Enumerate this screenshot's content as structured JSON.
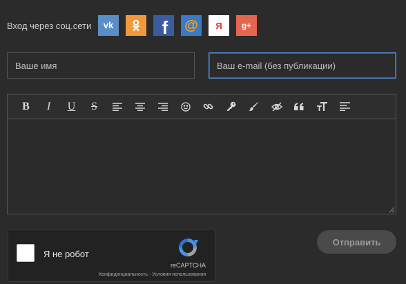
{
  "social": {
    "label": "Вход через соц.сети",
    "networks": [
      {
        "name": "vk",
        "text": "vk",
        "bg": "#5a8ec6",
        "fg": "#ffffff"
      },
      {
        "name": "odnoklassniki",
        "text": "",
        "bg": "#f19a3c",
        "fg": "#ffffff"
      },
      {
        "name": "facebook",
        "text": "f",
        "bg": "#3b5b9c",
        "fg": "#ffffff"
      },
      {
        "name": "mail-ru",
        "text": "@",
        "bg": "#3a7ac8",
        "fg": "#f6a521"
      },
      {
        "name": "yandex",
        "text": "Я",
        "bg": "#ffffff",
        "fg": "#e0332c"
      },
      {
        "name": "google-plus",
        "text": "g+",
        "bg": "#e46651",
        "fg": "#ffffff"
      }
    ]
  },
  "form": {
    "name_placeholder": "Ваше имя",
    "email_placeholder": "Ваш e-mail (без публикации)"
  },
  "editor": {
    "toolbar": [
      "bold",
      "italic",
      "underline",
      "strikethrough",
      "align-left",
      "align-center",
      "align-right",
      "emoji",
      "link",
      "key",
      "brush",
      "hide",
      "quote",
      "text-size",
      "list"
    ],
    "bold_label": "B",
    "italic_label": "I",
    "underline_label": "U",
    "strike_label": "S"
  },
  "captcha": {
    "label": "Я не робот",
    "brand": "reCAPTCHA",
    "links": "Конфиденциальность - Условия использования"
  },
  "submit_label": "Отправить"
}
